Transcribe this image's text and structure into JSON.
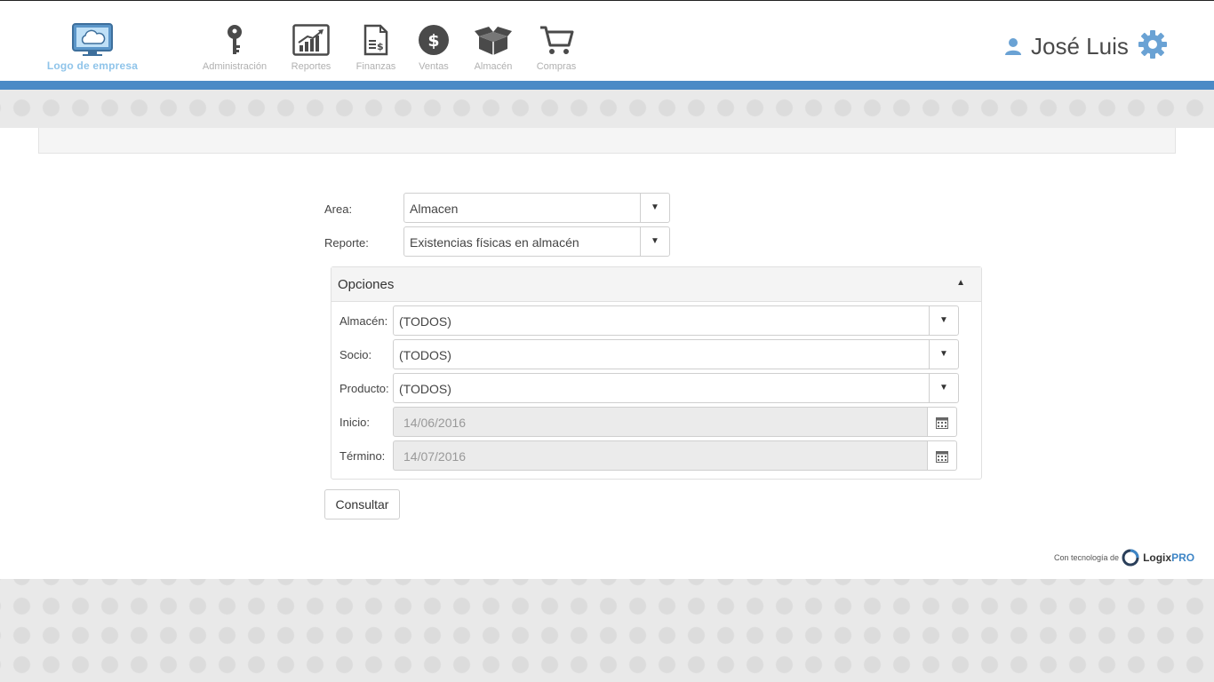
{
  "logo": {
    "text": "Logo de empresa"
  },
  "nav": {
    "items": [
      {
        "label": "Administración",
        "icon": "key-icon"
      },
      {
        "label": "Reportes",
        "icon": "chart-icon"
      },
      {
        "label": "Finanzas",
        "icon": "invoice-icon"
      },
      {
        "label": "Ventas",
        "icon": "dollar-icon"
      },
      {
        "label": "Almacén",
        "icon": "box-icon"
      },
      {
        "label": "Compras",
        "icon": "cart-icon"
      }
    ]
  },
  "user": {
    "name": "José Luis",
    "icon": "user-icon"
  },
  "settings": {
    "icon": "gear-icon"
  },
  "colors": {
    "brand_blue": "#4a8ac6",
    "logo_blue": "#8fc4ea"
  },
  "form": {
    "area": {
      "label": "Area:",
      "value": "Almacen"
    },
    "reporte": {
      "label": "Reporte:",
      "value": "Existencias físicas en almacén"
    }
  },
  "opciones": {
    "title": "Opciones",
    "almacen": {
      "label": "Almacén:",
      "value": "(TODOS)"
    },
    "socio": {
      "label": "Socio:",
      "value": "(TODOS)"
    },
    "producto": {
      "label": "Producto:",
      "value": "(TODOS)"
    },
    "inicio": {
      "label": "Inicio:",
      "value": "14/06/2016"
    },
    "termino": {
      "label": "Término:",
      "value": "14/07/2016"
    }
  },
  "actions": {
    "consultar": "Consultar"
  },
  "footer": {
    "powered_text": "Con tecnología de",
    "brand_main": "Logix",
    "brand_accent": "PRO"
  }
}
